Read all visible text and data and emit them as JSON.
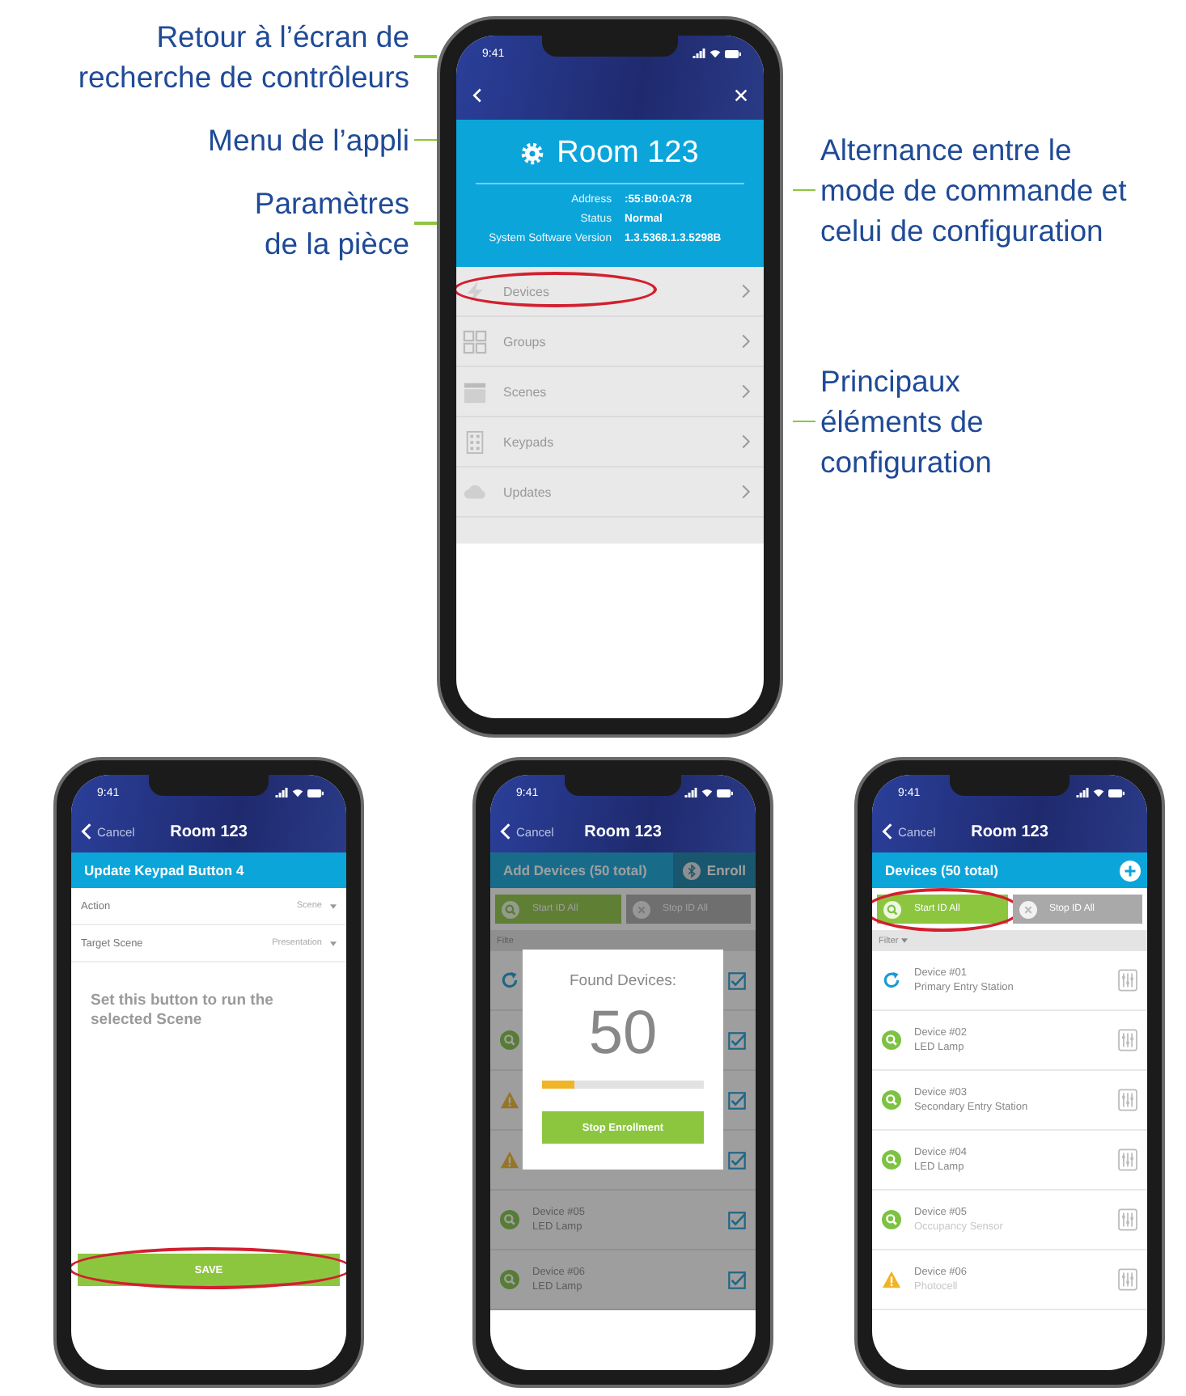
{
  "annotations_left": [
    {
      "lines": [
        "Retour à l’écran de",
        "recherche de contrôleurs"
      ]
    },
    {
      "lines": [
        "Menu de l’appli"
      ]
    },
    {
      "lines": [
        "Paramètres",
        "de la pièce"
      ]
    }
  ],
  "annotations_right": [
    {
      "lines": [
        "Alternance entre le",
        "mode de commande et",
        "celui de configuration"
      ]
    },
    {
      "lines": [
        "Principaux",
        "éléments de",
        "configuration"
      ]
    }
  ],
  "room_phone": {
    "time": "9:41",
    "title": "Room 123",
    "info": [
      {
        "label": "Address",
        "value": ":55:B0:0A:78"
      },
      {
        "label": "Status",
        "value": "Normal"
      },
      {
        "label": "System Software Version",
        "value": "1.3.5368.1.3.5298B"
      }
    ],
    "menu": [
      {
        "kind": "devices",
        "label": "Devices",
        "highlighted": true
      },
      {
        "kind": "groups",
        "label": "Groups",
        "highlighted": false
      },
      {
        "kind": "scenes",
        "label": "Scenes",
        "highlighted": false
      },
      {
        "kind": "keypads",
        "label": "Keypads",
        "highlighted": false
      },
      {
        "kind": "updates",
        "label": "Updates",
        "highlighted": false
      }
    ]
  },
  "keypad_phone": {
    "time": "9:41",
    "back": "Cancel",
    "title": "Room 123",
    "subtitle": "Update Keypad Button 4",
    "fields": [
      {
        "label": "Action",
        "value": "Scene"
      },
      {
        "label": "Target Scene",
        "value": "Presentation"
      }
    ],
    "message": "Set this button to run the selected Scene",
    "save": {
      "label": "SAVE",
      "highlighted": true
    }
  },
  "enroll_phone": {
    "time": "9:41",
    "back": "Cancel",
    "title": "Room 123",
    "subtitle": "Add Devices (50 total)",
    "enroll": "Enroll",
    "id_buttons": [
      {
        "kind": "start",
        "label": "Start ID All",
        "active": true,
        "highlighted": false
      },
      {
        "kind": "stop",
        "label": "Stop ID All",
        "active": false,
        "highlighted": false
      }
    ],
    "filter": "Filte",
    "devices": [
      {
        "kind": "refresh",
        "checked": true
      },
      {
        "kind": "search",
        "checked": true
      },
      {
        "kind": "warning",
        "checked": true
      },
      {
        "kind": "warning",
        "checked": true
      },
      {
        "kind": "search",
        "name": "Device #05",
        "type": "LED Lamp",
        "checked": true
      },
      {
        "kind": "search",
        "name": "Device #06",
        "type": "LED Lamp",
        "checked": true
      }
    ],
    "dialog": {
      "title": "Found Devices:",
      "count": "50",
      "level": 0.2,
      "button": "Stop Enrollment"
    }
  },
  "devices_phone": {
    "time": "9:41",
    "back": "Cancel",
    "title": "Room 123",
    "subtitle": "Devices (50 total)",
    "id_buttons": [
      {
        "kind": "start",
        "label": "Start ID All",
        "active": true,
        "highlighted": true
      },
      {
        "kind": "stop",
        "label": "Stop ID All",
        "active": false,
        "highlighted": false
      }
    ],
    "filter": "Filter",
    "devices": [
      {
        "kind": "refresh",
        "name": "Device #01",
        "type": "Primary Entry Station",
        "dimmed": false
      },
      {
        "kind": "search",
        "name": "Device #02",
        "type": "LED Lamp",
        "dimmed": false
      },
      {
        "kind": "search",
        "name": "Device #03",
        "type": "Secondary Entry Station",
        "dimmed": false
      },
      {
        "kind": "search",
        "name": "Device #04",
        "type": "LED Lamp",
        "dimmed": false
      },
      {
        "kind": "search",
        "name": "Device #05",
        "type": "Occupancy Sensor",
        "dimmed": true
      },
      {
        "kind": "warning",
        "name": "Device #06",
        "type": "Photocell",
        "dimmed": true
      }
    ]
  }
}
